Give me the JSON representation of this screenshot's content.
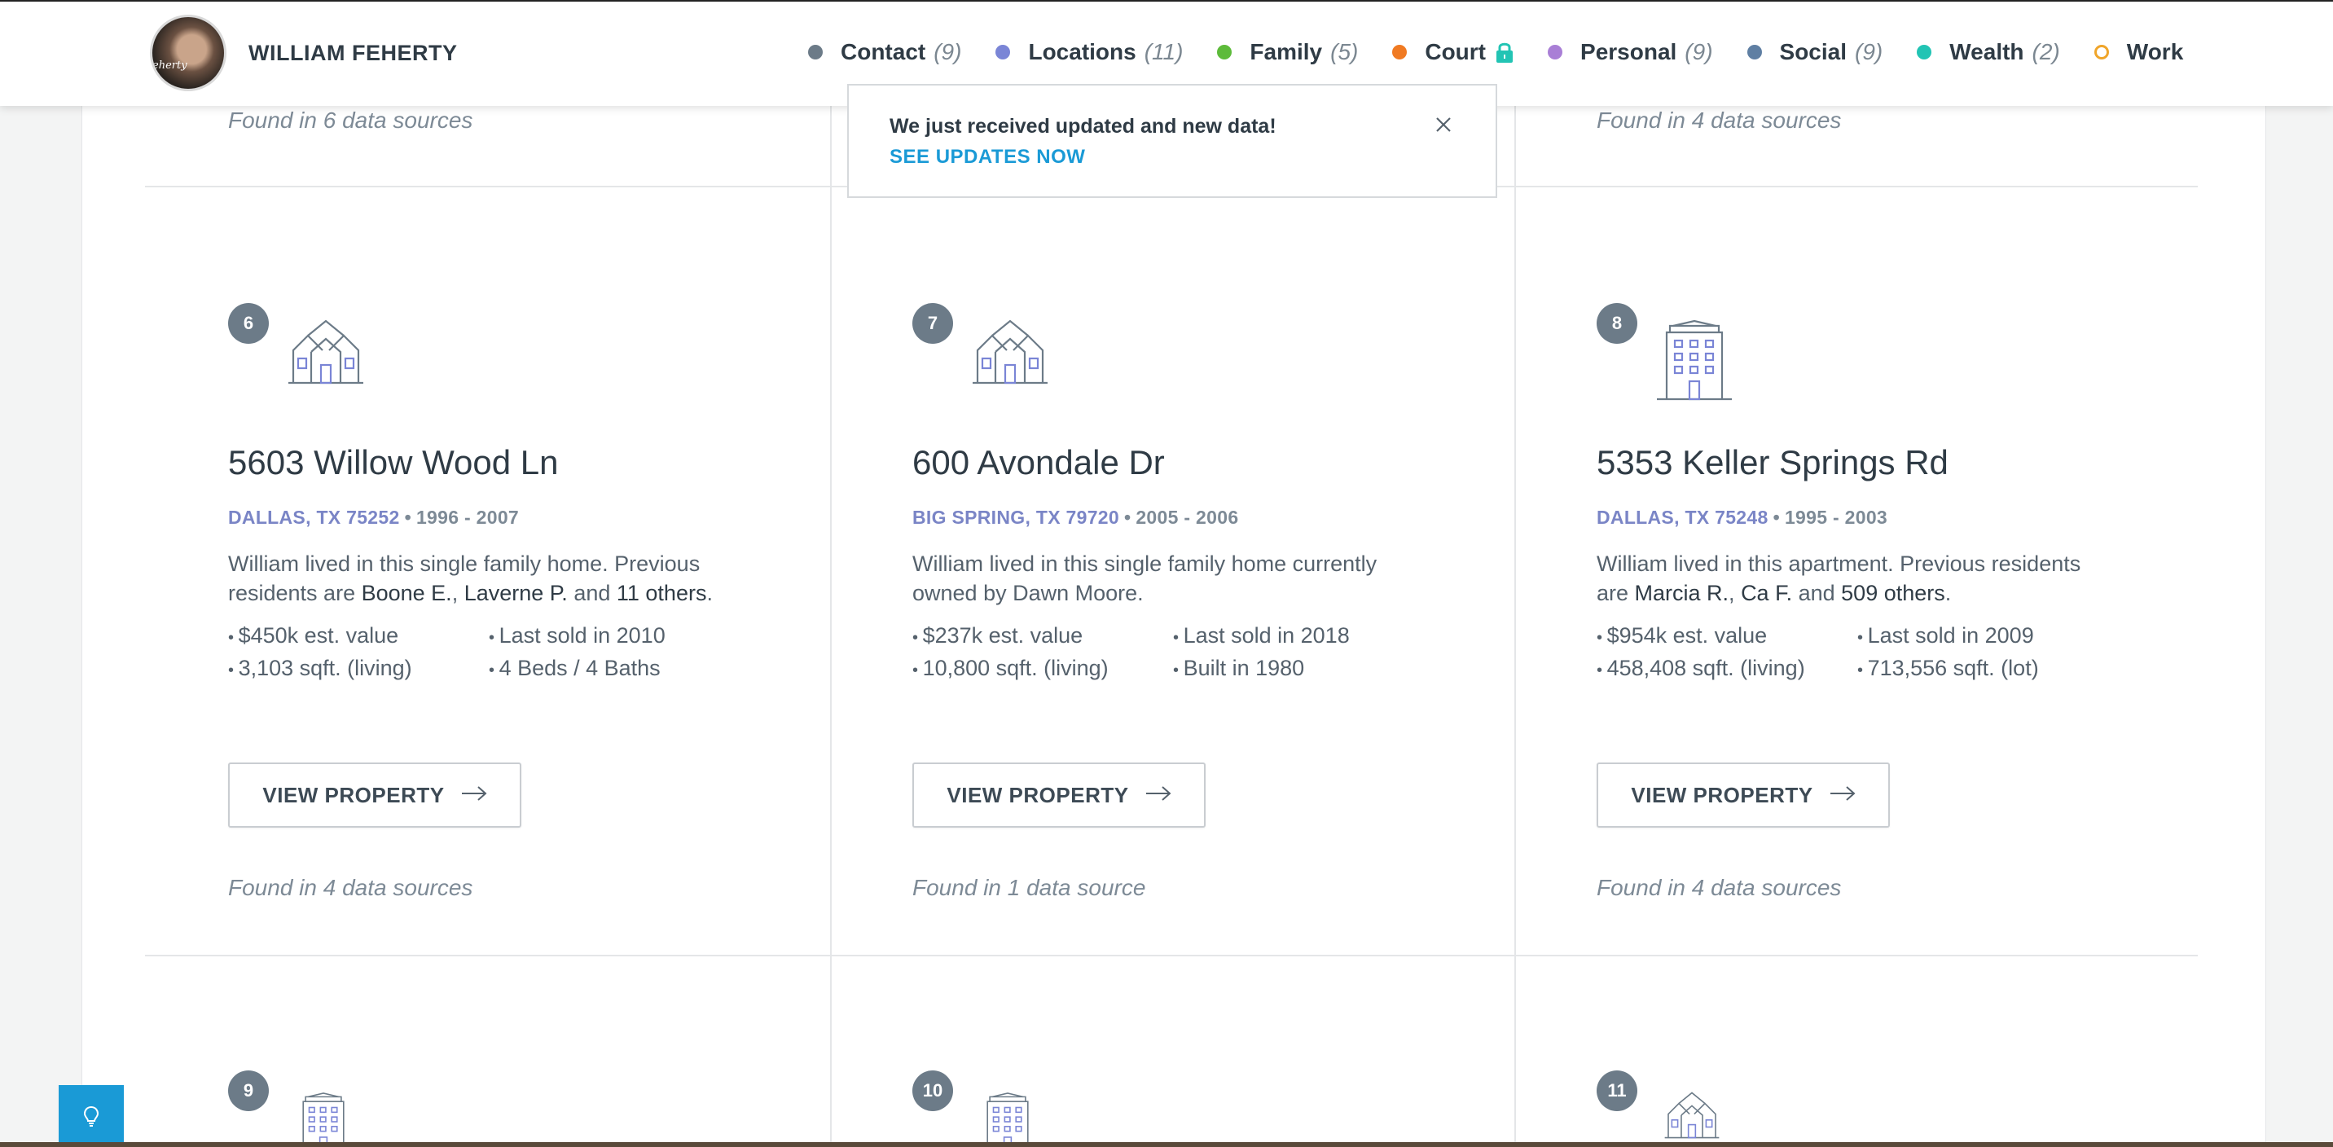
{
  "header": {
    "person_name": "WILLIAM FEHERTY",
    "avatar_caption": "eherty",
    "nav": [
      {
        "label": "Contact",
        "count": "(9)",
        "color": "#6c7b88"
      },
      {
        "label": "Locations",
        "count": "(11)",
        "color": "#7a85d6"
      },
      {
        "label": "Family",
        "count": "(5)",
        "color": "#5dbb3a"
      },
      {
        "label": "Court",
        "count": "",
        "color": "#f07a22",
        "locked": true
      },
      {
        "label": "Personal",
        "count": "(9)",
        "color": "#a97fd6"
      },
      {
        "label": "Social",
        "count": "(9)",
        "color": "#5f7fa3"
      },
      {
        "label": "Wealth",
        "count": "(2)",
        "color": "#22c4b4"
      },
      {
        "label": "Work",
        "count": "",
        "color": "#f0a52a",
        "hollow": true
      }
    ]
  },
  "notice": {
    "message": "We just received updated and new data!",
    "link": "SEE UPDATES NOW"
  },
  "top_row_found": [
    "Found in 6 data sources",
    "Found in 4 data sources"
  ],
  "properties": [
    {
      "number": "6",
      "icon": "house-icon",
      "address": "5603 Willow Wood Ln",
      "city": "DALLAS, TX 75252",
      "years": "1996 - 2007",
      "desc_pre": "William lived in this single family home. Previous residents are ",
      "desc_name1": "Boone E.",
      "desc_sep": ", ",
      "desc_name2": "Laverne P.",
      "desc_and": " and ",
      "desc_others": "11 others",
      "desc_end": ".",
      "facts": [
        "$450k est. value",
        "Last sold in 2010",
        "3,103 sqft. (living)",
        "4 Beds / 4 Baths"
      ],
      "button": "VIEW PROPERTY",
      "found": "Found in 4 data sources"
    },
    {
      "number": "7",
      "icon": "house-icon",
      "address": "600 Avondale Dr",
      "city": "BIG SPRING, TX 79720",
      "years": "2005 - 2006",
      "desc_pre": "William lived in this single family home currently owned by Dawn Moore.",
      "facts": [
        "$237k est. value",
        "Last sold in 2018",
        "10,800 sqft. (living)",
        "Built in 1980"
      ],
      "button": "VIEW PROPERTY",
      "found": "Found in 1 data source"
    },
    {
      "number": "8",
      "icon": "apartment-building-icon",
      "address": "5353 Keller Springs Rd",
      "city": "DALLAS, TX 75248",
      "years": "1995 - 2003",
      "desc_pre": "William lived in this apartment. Previous residents are ",
      "desc_name1": "Marcia R.",
      "desc_sep": ", ",
      "desc_name2": "Ca F.",
      "desc_and": " and ",
      "desc_others": "509 others",
      "desc_end": ".",
      "facts": [
        "$954k est. value",
        "Last sold in 2009",
        "458,408 sqft. (living)",
        "713,556 sqft. (lot)"
      ],
      "button": "VIEW PROPERTY",
      "found": "Found in 4 data sources"
    }
  ],
  "next_row_numbers": [
    "9",
    "10",
    "11"
  ]
}
